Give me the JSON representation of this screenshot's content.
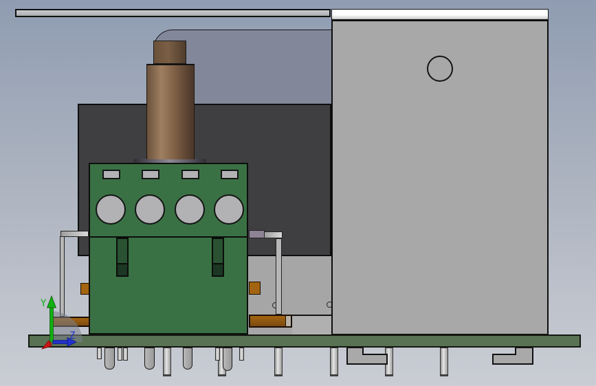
{
  "axis_triad": {
    "y_label": "Y",
    "z_label": "Z"
  },
  "colors": {
    "bg_top": "#8f9cb1",
    "bg_mid": "#adb4c0",
    "bg_bottom": "#cacdd4",
    "bar_top": "#cbccce",
    "bar_bottom": "#a9abae",
    "strip_white": "#ffffff",
    "box_gray": "#a8a8a9",
    "housing_dark": "#3f3f41",
    "backplate": "#828899",
    "panel": "#a6a6a7",
    "panel_light": "#b0b0b1",
    "pcb": "#3a7144",
    "slot": "#2a5232",
    "slot_dark": "#1c3723",
    "board": "#5a7254",
    "pad": "#b3b3b5",
    "hole": "#b2b2b4",
    "shaft_hi": "#9f7f60",
    "shaft_mid": "#7b5d43",
    "shaft_dark": "#4e392b",
    "knob": "#6a5139",
    "knob_dark": "#503c2d",
    "flange_mid": "#8d8896",
    "flange_edge": "#2e2c33",
    "copper": "#7c4a10",
    "copper_hi": "#a26410",
    "copper_end": "#b8b2a4",
    "bracket": "#b7b7b7",
    "purple": "#8d8394",
    "pin_hi": "#e8e8e8",
    "pin_mid": "#9a9a9a",
    "pin_dark": "#414141",
    "axis_y": "#12b012",
    "axis_z": "#2233cc",
    "axis_x": "#cc1515"
  }
}
